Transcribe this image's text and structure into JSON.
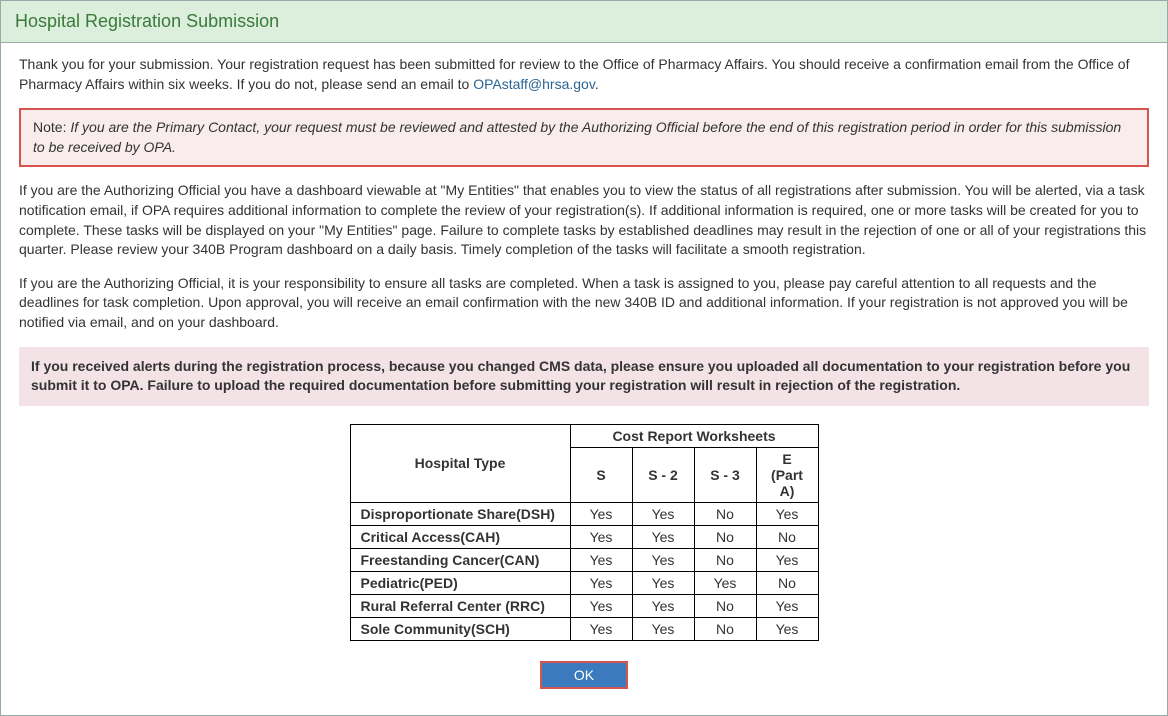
{
  "header": {
    "title": "Hospital Registration Submission"
  },
  "thankyou": {
    "text_before_link": "Thank you for your submission. Your registration request has been submitted for review to the Office of Pharmacy Affairs. You should receive a confirmation email from the Office of Pharmacy Affairs within six weeks. If you do not, please send an email to ",
    "link_text": "OPAstaff@hrsa.gov",
    "text_after_link": "."
  },
  "note": {
    "label": "Note: ",
    "text": "If you are the Primary Contact, your request must be reviewed and attested by the Authorizing Official before the end of this registration period in order for this submission to be received by OPA."
  },
  "paragraph2": "If you are the Authorizing Official you have a dashboard viewable at \"My Entities\" that enables you to view the status of all registrations after submission. You will be alerted, via a task notification email, if OPA requires additional information to complete the review of your registration(s). If additional information is required, one or more tasks will be created for you to complete. These tasks will be displayed on your \"My Entities\" page. Failure to complete tasks by established deadlines may result in the rejection of one or all of your registrations this quarter. Please review your 340B Program dashboard on a daily basis. Timely completion of the tasks will facilitate a smooth registration.",
  "paragraph3": "If you are the Authorizing Official, it is your responsibility to ensure all tasks are completed. When a task is assigned to you, please pay careful attention to all requests and the deadlines for task completion. Upon approval, you will receive an email confirmation with the new 340B ID and additional information. If your registration is not approved you will be notified via email, and on your dashboard.",
  "alert": "If you received alerts during the registration process, because you changed CMS data, please ensure you uploaded all documentation to your registration before you submit it to OPA. Failure to upload the required documentation before submitting your registration will result in rejection of the registration.",
  "table": {
    "header_hospital_type": "Hospital Type",
    "header_group": "Cost Report Worksheets",
    "columns": [
      "S",
      "S - 2",
      "S - 3",
      "E (Part A)"
    ],
    "rows": [
      {
        "label": "Disproportionate Share(DSH)",
        "values": [
          "Yes",
          "Yes",
          "No",
          "Yes"
        ]
      },
      {
        "label": "Critical Access(CAH)",
        "values": [
          "Yes",
          "Yes",
          "No",
          "No"
        ]
      },
      {
        "label": "Freestanding Cancer(CAN)",
        "values": [
          "Yes",
          "Yes",
          "No",
          "Yes"
        ]
      },
      {
        "label": "Pediatric(PED)",
        "values": [
          "Yes",
          "Yes",
          "Yes",
          "No"
        ]
      },
      {
        "label": "Rural Referral Center (RRC)",
        "values": [
          "Yes",
          "Yes",
          "No",
          "Yes"
        ]
      },
      {
        "label": "Sole Community(SCH)",
        "values": [
          "Yes",
          "Yes",
          "No",
          "Yes"
        ]
      }
    ]
  },
  "button": {
    "ok_label": "OK"
  }
}
